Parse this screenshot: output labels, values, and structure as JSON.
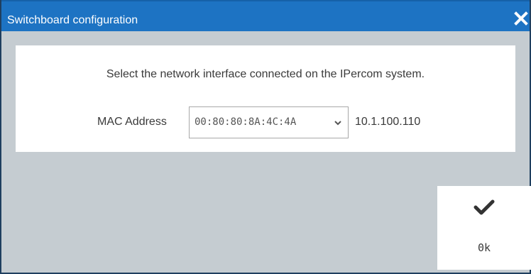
{
  "window": {
    "title": "Switchboard configuration"
  },
  "dialog": {
    "instruction": "Select the network interface connected on the IPercom system.",
    "mac_label": "MAC Address",
    "mac_selected": "00:80:80:8A:4C:4A",
    "ip_address": "10.1.100.110"
  },
  "actions": {
    "ok_label": "0k"
  },
  "icons": {
    "close": "close-icon",
    "dropdown": "chevron-down-icon",
    "confirm": "checkmark-icon"
  },
  "colors": {
    "titlebar": "#1d73c3",
    "background": "#c5ccd1",
    "panel": "#ffffff",
    "text": "#3a3a3a"
  }
}
